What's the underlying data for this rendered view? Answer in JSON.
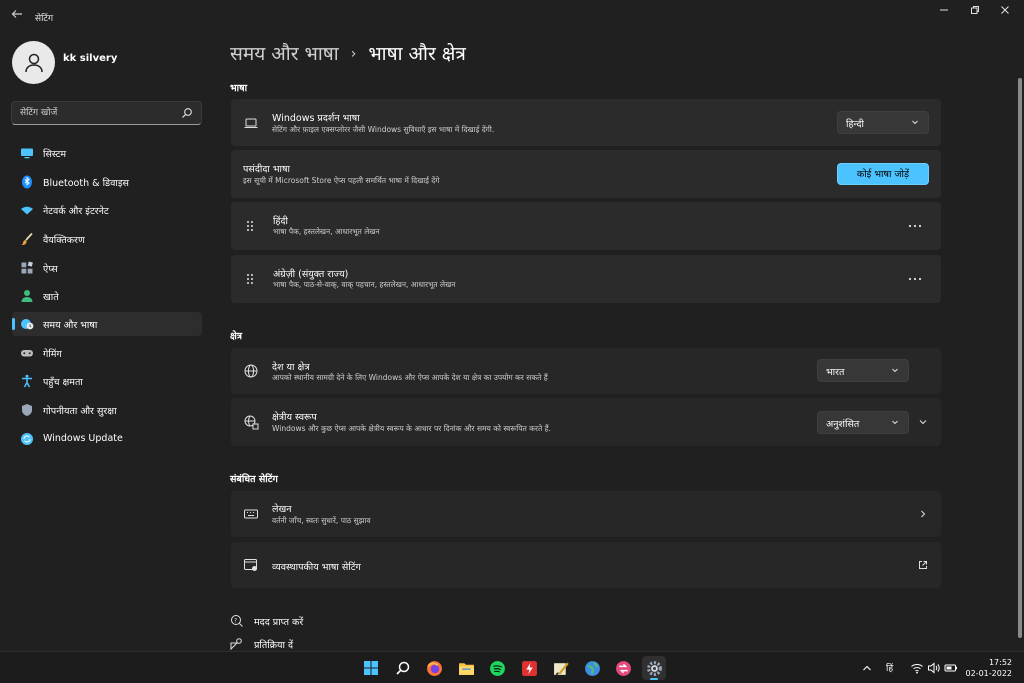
{
  "window": {
    "title": "सेटिंग",
    "back_icon": "arrow-left-icon",
    "controls": [
      "minimize-icon",
      "restore-icon",
      "close-icon"
    ]
  },
  "user": {
    "name": "kk silvery"
  },
  "search": {
    "placeholder": "सेटिंग खोजें"
  },
  "sidebar": {
    "items": [
      {
        "label": "सिस्टम",
        "icon": "monitor-icon",
        "color": "#4cc2ff"
      },
      {
        "label": "Bluetooth & डिवाइस",
        "icon": "bluetooth-icon",
        "color": "#1e90ff"
      },
      {
        "label": "नेटवर्क और इंटरनेट",
        "icon": "wifi-icon",
        "color": "#4cc2ff"
      },
      {
        "label": "वैयक्तिकरण",
        "icon": "brush-icon",
        "color": "#f4a340"
      },
      {
        "label": "ऐप्स",
        "icon": "apps-icon",
        "color": "#9aa7b8"
      },
      {
        "label": "खाते",
        "icon": "person-icon",
        "color": "#3fbf7f"
      },
      {
        "label": "समय और भाषा",
        "icon": "globe-clock-icon",
        "color": "#4cc2ff",
        "selected": true
      },
      {
        "label": "गेमिंग",
        "icon": "gamepad-icon",
        "color": "#bdbdbd"
      },
      {
        "label": "पहुँच क्षमता",
        "icon": "accessibility-icon",
        "color": "#4cc2ff"
      },
      {
        "label": "गोपनीयता और सुरक्षा",
        "icon": "shield-icon",
        "color": "#9aa7b8"
      },
      {
        "label": "Windows Update",
        "icon": "sync-icon",
        "color": "#4cc2ff"
      }
    ]
  },
  "breadcrumb": {
    "parent": "समय और भाषा",
    "separator": "›",
    "current": "भाषा और क्षेत्र"
  },
  "sections": {
    "language": {
      "heading": "भाषा",
      "display_language": {
        "title": "Windows प्रदर्शन भाषा",
        "subtitle": "सेटिंग और फ़ाइल एक्सप्लोरर जैसी Windows सुविधाएँ इस भाषा में दिखाई देंगी.",
        "value": "हिन्दी"
      },
      "preferred": {
        "title": "पसंदीदा भाषा",
        "subtitle": "इस सूची में Microsoft Store ऐप्स पहली समर्थित भाषा में दिखाई देंगे",
        "button": "कोई भाषा जोड़ें"
      },
      "languages": [
        {
          "name": "हिंदी",
          "features": "भाषा पैक, हस्तलेखन, आधारभूत लेखन"
        },
        {
          "name": "अंग्रेज़ी (संयुक्त राज्य)",
          "features": "भाषा पैक, पाठ-से-वाक्, वाक् पहचान, हस्तलेखन, आधारभूत लेखन"
        }
      ]
    },
    "region": {
      "heading": "क्षेत्र",
      "country": {
        "title": "देश या क्षेत्र",
        "subtitle": "आपको स्थानीय सामग्री देने के लिए Windows और ऐप्स आपके देश या क्षेत्र का उपयोग कर सकते हैं",
        "value": "भारत"
      },
      "format": {
        "title": "क्षेत्रीय स्वरूप",
        "subtitle": "Windows और कुछ ऐप्स आपके क्षेत्रीय स्वरूप के आधार पर दिनांक और समय को स्वरूपित करते हैं.",
        "value": "अनुशंसित"
      }
    },
    "related": {
      "heading": "संबंधित सेटिंग",
      "typing": {
        "title": "लेखन",
        "subtitle": "वर्तनी जाँच, स्वतः सुधारें, पाठ सुझाव"
      },
      "admin": {
        "title": "व्यवस्थापकीय भाषा सेटिंग"
      }
    }
  },
  "links": {
    "help": "मदद प्राप्त करें",
    "feedback": "प्रतिक्रिया दें"
  },
  "taskbar": {
    "apps": [
      "windows-start-icon",
      "search-icon",
      "firefox-icon",
      "file-explorer-icon",
      "spotify-icon",
      "flash-app-icon",
      "paint-app-icon",
      "globe-app-icon",
      "redirect-app-icon",
      "settings-icon"
    ],
    "tray": {
      "ime": "हिं",
      "time": "17:52",
      "date": "02-01-2022"
    }
  },
  "accent": "#4cc2ff"
}
